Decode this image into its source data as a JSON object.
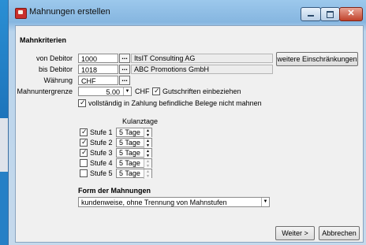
{
  "window": {
    "title": "Mahnungen erstellen"
  },
  "criteria": {
    "heading": "Mahnkriterien",
    "von_label": "von Debitor",
    "von_value": "1000",
    "von_name": "ItsIT Consulting AG",
    "bis_label": "bis Debitor",
    "bis_value": "1018",
    "bis_name": "ABC Promotions GmbH",
    "waehrung_label": "Währung",
    "waehrung_value": "CHF",
    "grenze_label": "Mahnuntergrenze",
    "grenze_value": "5.00",
    "grenze_unit": "CHF",
    "gutschriften_label": "Gutschriften einbeziehen",
    "vollstaendig_label": "vollständig in Zahlung befindliche Belege nicht mahnen",
    "ellipsis": "...",
    "weitere_label": "weitere Einschränkungen"
  },
  "kulanz": {
    "header": "Kulanztage",
    "stufen": [
      {
        "label": "Stufe 1",
        "checked": true,
        "value": "5 Tage"
      },
      {
        "label": "Stufe 2",
        "checked": true,
        "value": "5 Tage"
      },
      {
        "label": "Stufe 3",
        "checked": true,
        "value": "5 Tage"
      },
      {
        "label": "Stufe 4",
        "checked": false,
        "value": "5 Tage"
      },
      {
        "label": "Stufe 5",
        "checked": false,
        "value": "5 Tage"
      }
    ]
  },
  "form": {
    "heading": "Form der Mahnungen",
    "selected": "kundenweise, ohne Trennung von Mahnstufen"
  },
  "buttons": {
    "weiter": "Weiter >",
    "abbrechen": "Abbrechen"
  },
  "icons": {
    "check": "✓",
    "dropdown": "▼",
    "up": "▲",
    "down": "▼",
    "close": "✕"
  }
}
